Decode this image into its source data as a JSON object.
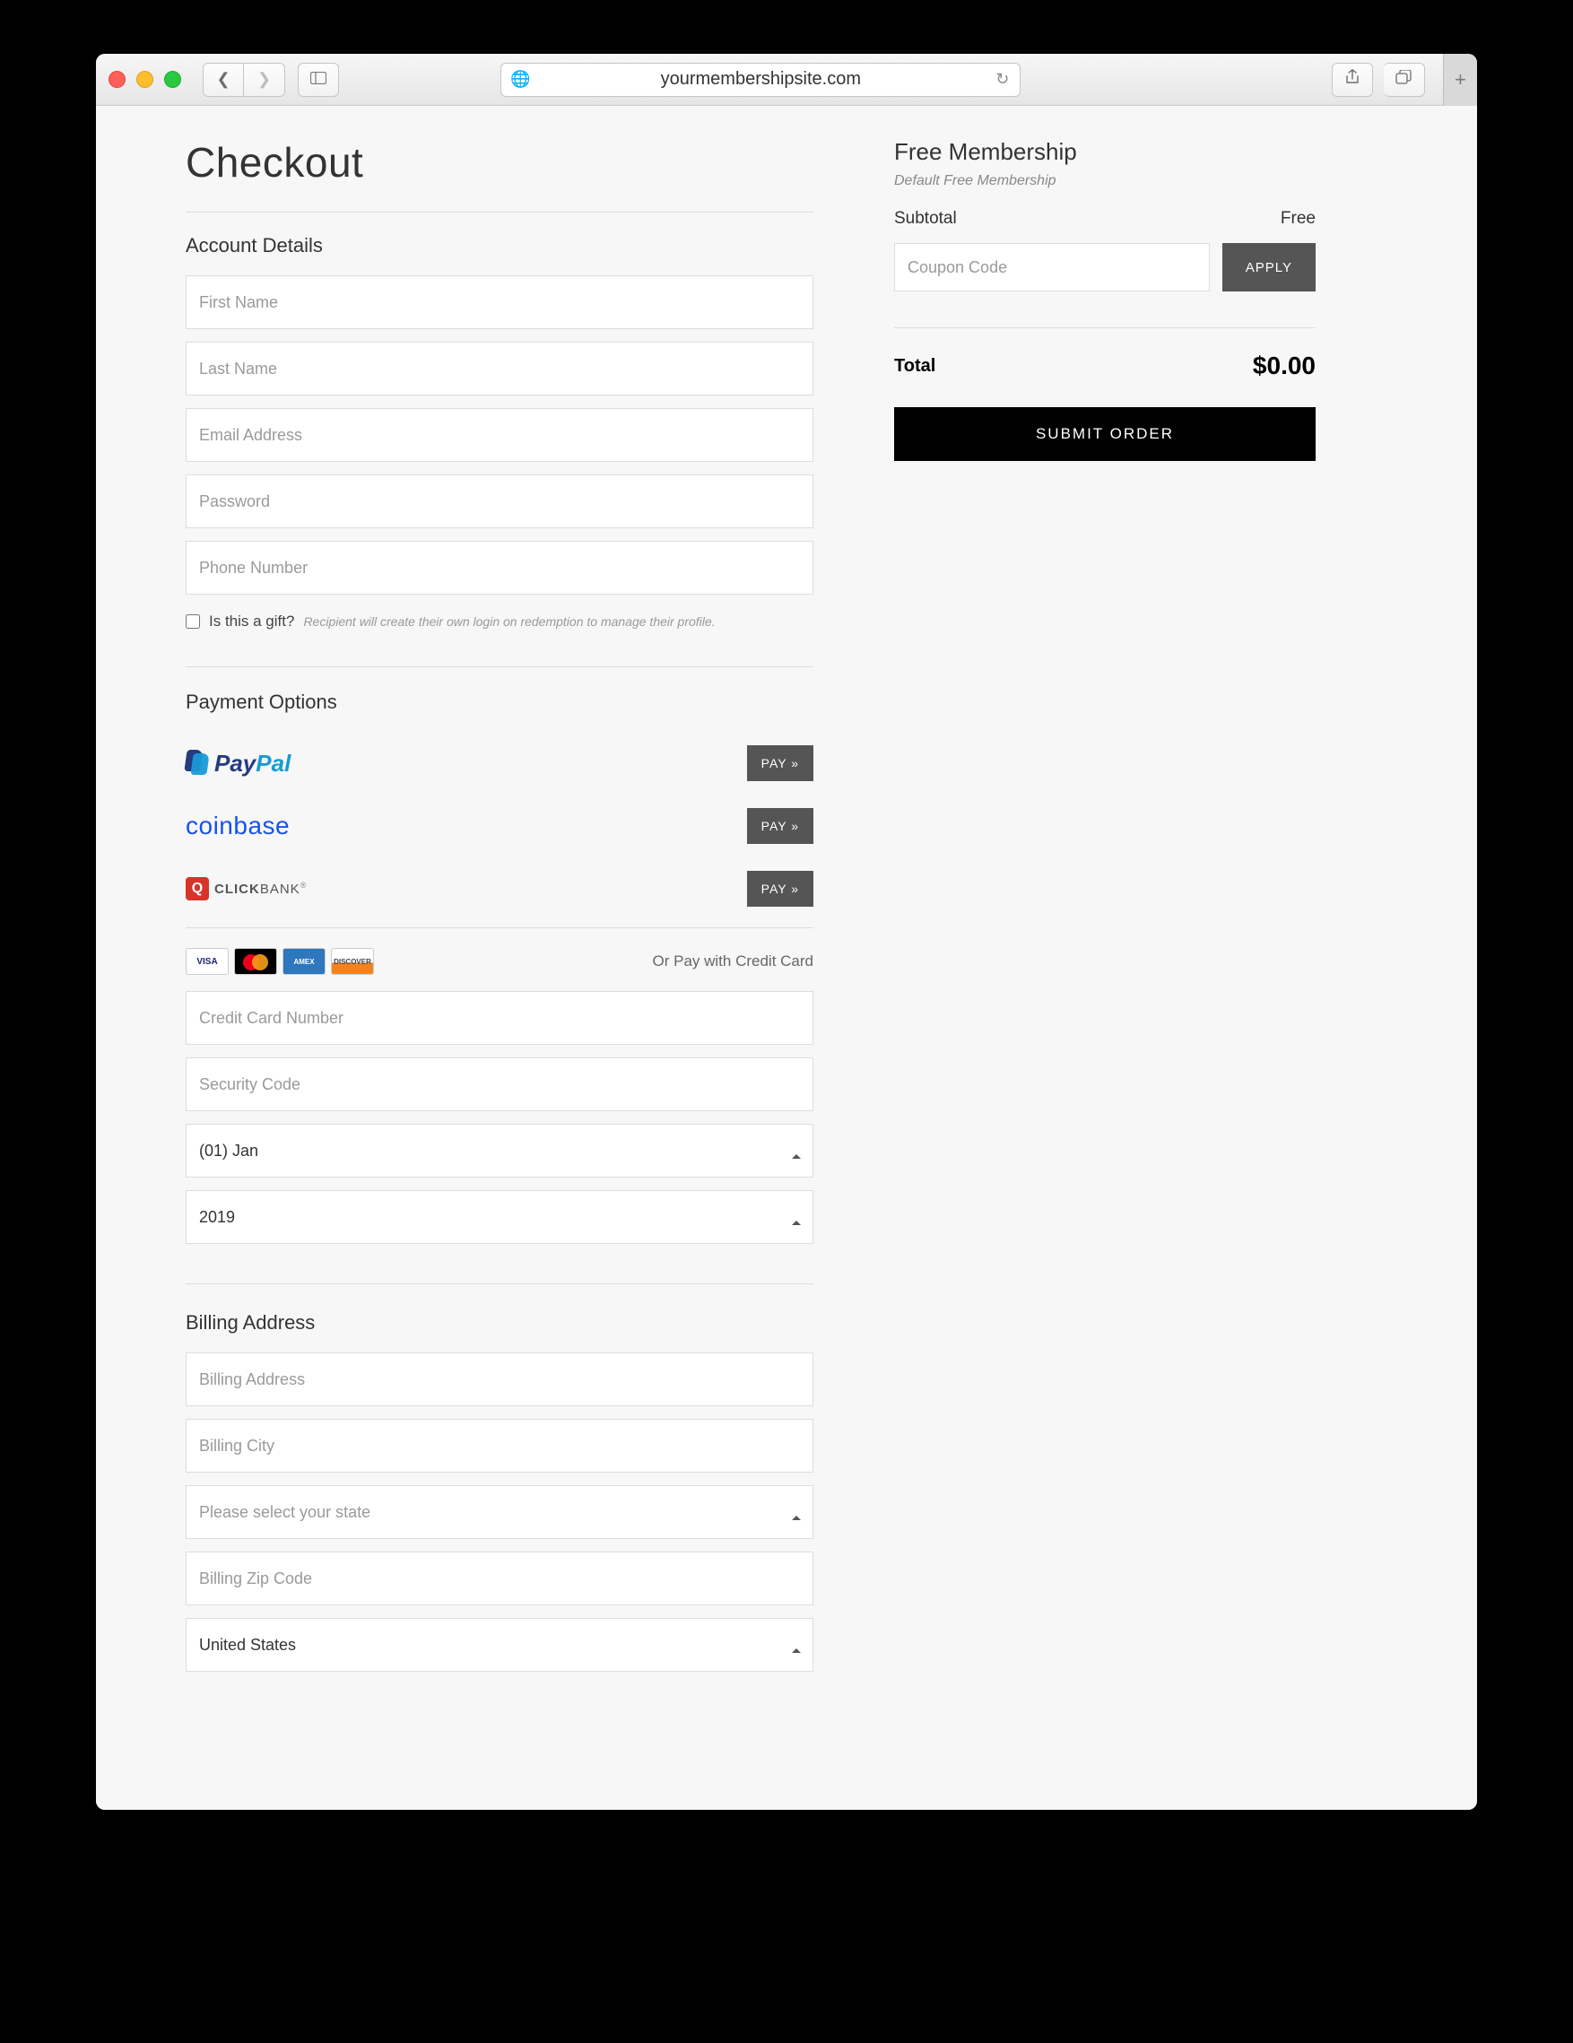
{
  "browser": {
    "url": "yourmembershipsite.com"
  },
  "checkout": {
    "title": "Checkout",
    "account": {
      "heading": "Account Details",
      "first_name_ph": "First Name",
      "last_name_ph": "Last Name",
      "email_ph": "Email Address",
      "password_ph": "Password",
      "phone_ph": "Phone Number",
      "gift_label": "Is this a gift?",
      "gift_hint": "Recipient will create their own login on redemption to manage their profile."
    },
    "payment": {
      "heading": "Payment Options",
      "pay_btn": "PAY »",
      "providers": {
        "paypal": "PayPal",
        "coinbase": "coinbase",
        "clickbank": "CLICKBANK"
      },
      "cc_label": "Or Pay with Credit Card",
      "cc_number_ph": "Credit Card Number",
      "cc_security_ph": "Security Code",
      "cc_month": "(01) Jan",
      "cc_year": "2019"
    },
    "billing": {
      "heading": "Billing Address",
      "address_ph": "Billing Address",
      "city_ph": "Billing City",
      "state_ph": "Please select your state",
      "zip_ph": "Billing Zip Code",
      "country": "United States"
    }
  },
  "summary": {
    "product_title": "Free Membership",
    "product_sub": "Default Free Membership",
    "subtotal_label": "Subtotal",
    "subtotal_value": "Free",
    "coupon_ph": "Coupon Code",
    "apply_label": "APPLY",
    "total_label": "Total",
    "total_value": "$0.00",
    "submit_label": "SUBMIT ORDER"
  }
}
